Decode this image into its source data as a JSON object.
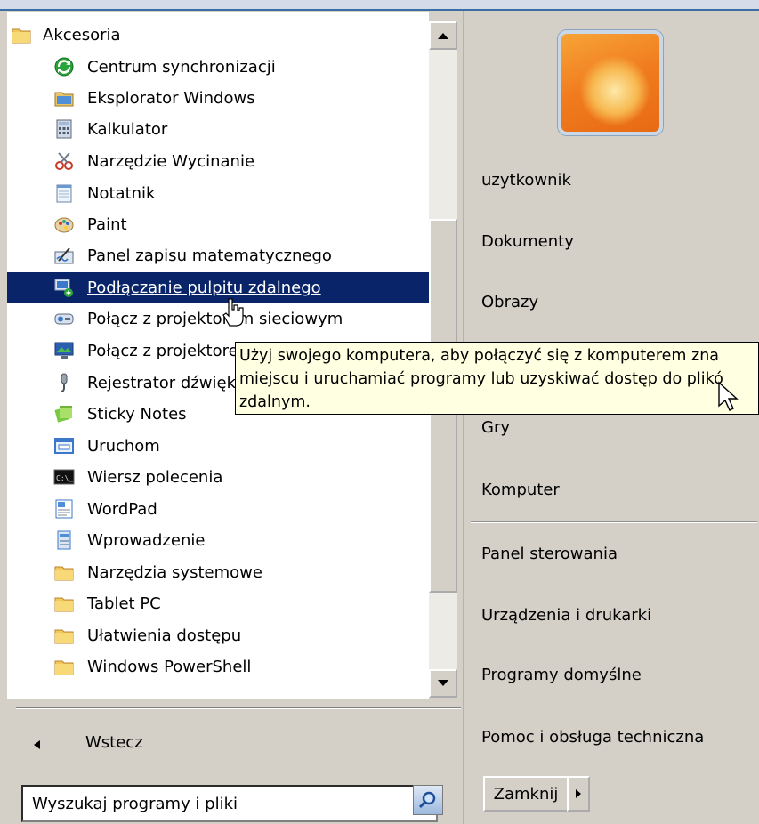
{
  "left_panel": {
    "items": [
      {
        "label": "Akcesoria",
        "icon": "folder-icon"
      },
      {
        "label": "Centrum synchronizacji",
        "icon": "sync-center-icon"
      },
      {
        "label": "Eksplorator Windows",
        "icon": "explorer-icon"
      },
      {
        "label": "Kalkulator",
        "icon": "calculator-icon"
      },
      {
        "label": "Narzędzie Wycinanie",
        "icon": "scissors-icon"
      },
      {
        "label": "Notatnik",
        "icon": "notepad-icon"
      },
      {
        "label": "Paint",
        "icon": "paint-palette-icon"
      },
      {
        "label": "Panel zapisu matematycznego",
        "icon": "math-input-icon"
      },
      {
        "label": "Podłączanie pulpitu zdalnego",
        "icon": "remote-desktop-icon"
      },
      {
        "label": "Połącz z projektorem sieciowym",
        "icon": "network-projector-icon"
      },
      {
        "label": "Połącz z projektorem",
        "icon": "projector-icon"
      },
      {
        "label": "Rejestrator dźwięku",
        "icon": "microphone-icon"
      },
      {
        "label": "Sticky Notes",
        "icon": "sticky-notes-icon"
      },
      {
        "label": "Uruchom",
        "icon": "run-icon"
      },
      {
        "label": "Wiersz polecenia",
        "icon": "command-prompt-icon"
      },
      {
        "label": "WordPad",
        "icon": "wordpad-icon"
      },
      {
        "label": "Wprowadzenie",
        "icon": "getting-started-icon"
      },
      {
        "label": "Narzędzia systemowe",
        "icon": "folder-icon"
      },
      {
        "label": "Tablet PC",
        "icon": "folder-icon"
      },
      {
        "label": "Ułatwienia dostępu",
        "icon": "folder-icon"
      },
      {
        "label": "Windows PowerShell",
        "icon": "folder-icon"
      }
    ],
    "back_label": "Wstecz",
    "search_placeholder": "Wyszukaj programy i pliki"
  },
  "tooltip": {
    "line1": "Użyj swojego komputera, aby połączyć się z komputerem zna",
    "line2": "miejscu i uruchamiać programy lub uzyskiwać dostęp do plikó",
    "line3": "zdalnym."
  },
  "right_panel": {
    "links": {
      "user": "uzytkownik",
      "documents": "Dokumenty",
      "pictures": "Obrazy",
      "games": "Gry",
      "computer": "Komputer",
      "control_panel": "Panel sterowania",
      "devices": "Urządzenia i drukarki",
      "default_programs": "Programy domyślne",
      "help": "Pomoc i obsługa techniczna"
    },
    "shutdown_label": "Zamknij"
  },
  "colors": {
    "selection": "#0a246a",
    "tooltip_bg": "#ffffe1",
    "panel_bg": "#d4d0c8"
  }
}
